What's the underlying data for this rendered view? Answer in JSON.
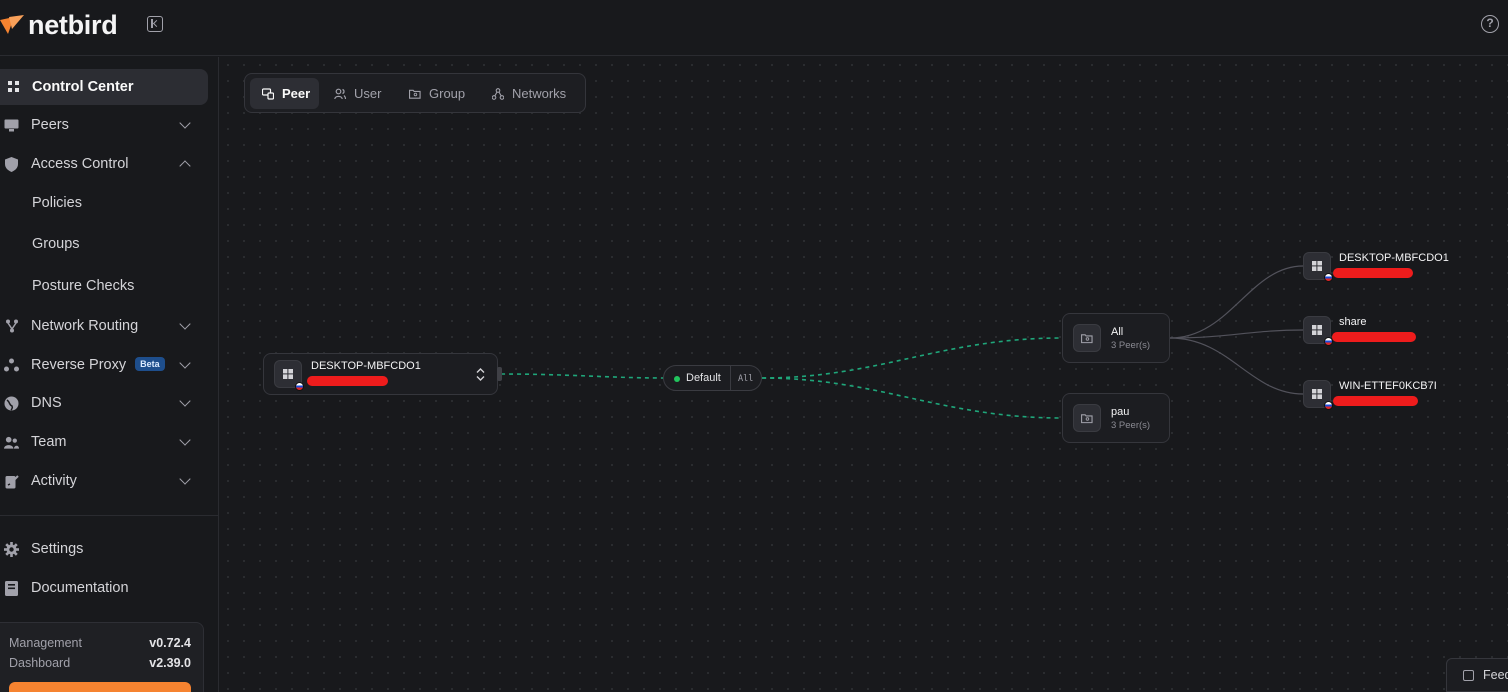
{
  "app": {
    "name": "netbird"
  },
  "sidebar": {
    "items": [
      {
        "label": "Control Center",
        "icon": "grid-icon",
        "active": true
      },
      {
        "label": "Peers",
        "icon": "monitor-icon",
        "expandable": true
      },
      {
        "label": "Access Control",
        "icon": "shield-icon",
        "expandable": true,
        "expanded": true,
        "children": [
          {
            "label": "Policies"
          },
          {
            "label": "Groups"
          },
          {
            "label": "Posture Checks"
          }
        ]
      },
      {
        "label": "Network Routing",
        "icon": "network-icon",
        "expandable": true
      },
      {
        "label": "Reverse Proxy",
        "icon": "proxy-icon",
        "badge": "Beta",
        "expandable": true
      },
      {
        "label": "DNS",
        "icon": "globe-icon",
        "expandable": true
      },
      {
        "label": "Team",
        "icon": "team-icon",
        "expandable": true
      },
      {
        "label": "Activity",
        "icon": "activity-icon",
        "expandable": true
      },
      {
        "label": "Settings",
        "icon": "gear-icon"
      },
      {
        "label": "Documentation",
        "icon": "book-icon"
      }
    ],
    "versions": [
      {
        "label": "Management",
        "value": "v0.72.4"
      },
      {
        "label": "Dashboard",
        "value": "v2.39.0"
      }
    ]
  },
  "tabs": [
    {
      "label": "Peer",
      "active": true
    },
    {
      "label": "User"
    },
    {
      "label": "Group"
    },
    {
      "label": "Networks"
    }
  ],
  "graph": {
    "source_peer": {
      "name": "DESKTOP-MBFCDO1"
    },
    "policy": {
      "name": "Default",
      "ports": "All",
      "status_color": "#22c55e"
    },
    "groups": [
      {
        "name": "All",
        "count": "3 Peer(s)"
      },
      {
        "name": "pau",
        "count": "3 Peer(s)"
      }
    ],
    "peers": [
      {
        "name": "DESKTOP-MBFCDO1"
      },
      {
        "name": "share"
      },
      {
        "name": "WIN-ETTEF0KCB7I"
      }
    ]
  },
  "feedback": {
    "label": "Feed"
  },
  "colors": {
    "accent": "#f68330",
    "edge_dashed": "#1fa67a",
    "redaction": "#ee1c1c"
  }
}
